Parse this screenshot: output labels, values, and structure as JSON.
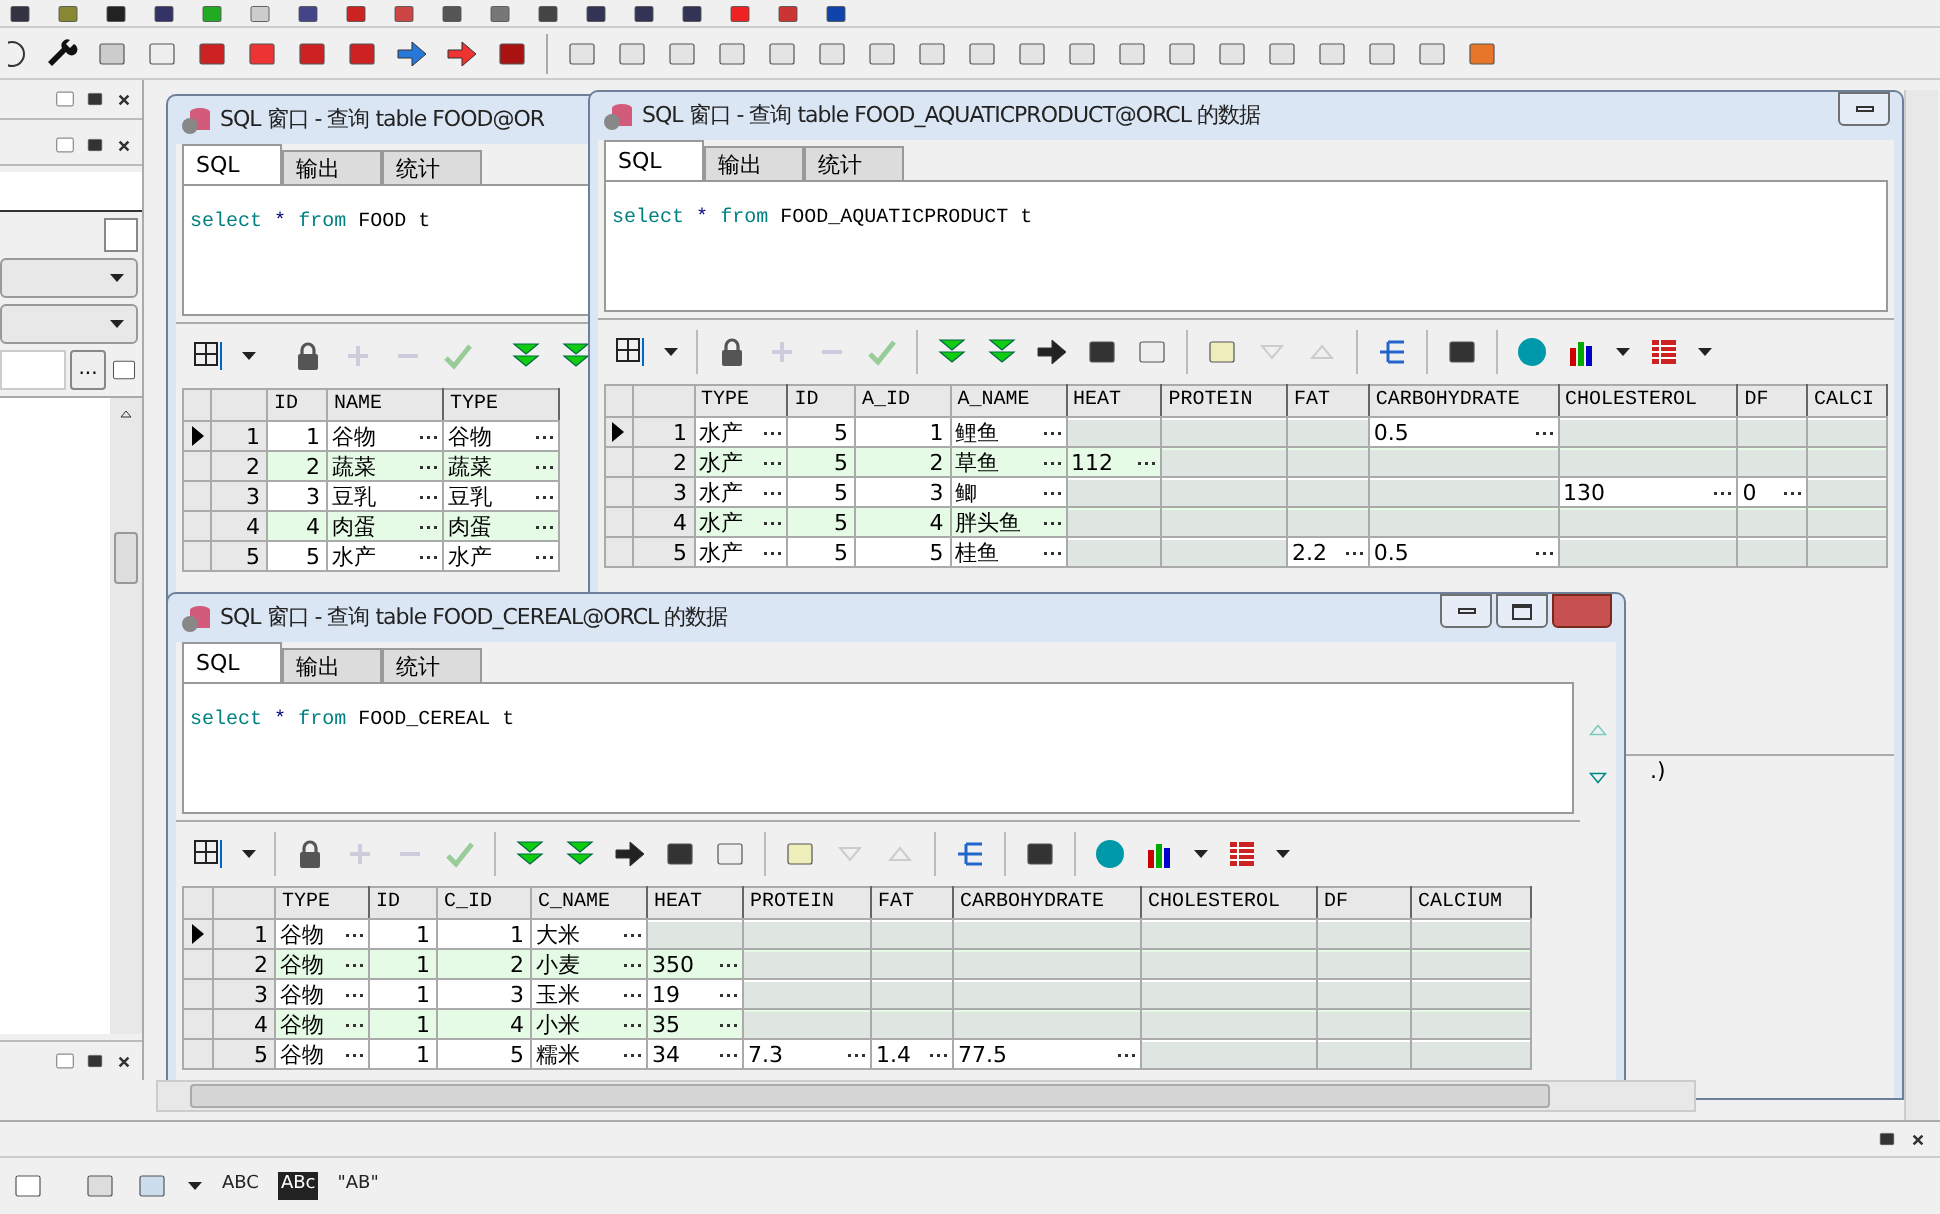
{
  "output_panel": {
    "toolbar_texts": [
      "ABC",
      "ABc",
      "\"AB\""
    ]
  },
  "left_panel": {
    "browse_button": "..."
  },
  "windows": [
    {
      "title": "SQL 窗口 - 查询 table FOOD@OR",
      "tabs": [
        {
          "label": "SQL",
          "selected": true
        },
        {
          "label": "输出",
          "selected": false
        },
        {
          "label": "统计",
          "selected": false
        }
      ],
      "sql": [
        {
          "kind": "keyword",
          "text": "select"
        },
        {
          "kind": "operator",
          "text": "*"
        },
        {
          "kind": "keyword",
          "text": "from"
        },
        {
          "kind": "plain",
          "text": "FOOD t"
        }
      ],
      "columns": [
        {
          "name": "ID",
          "kind": "number"
        },
        {
          "name": "NAME",
          "kind": "text"
        },
        {
          "name": "TYPE",
          "kind": "text"
        }
      ],
      "rows": [
        {
          "number": "1",
          "selected": true,
          "cells": [
            "1",
            "谷物",
            "谷物"
          ]
        },
        {
          "number": "2",
          "selected": false,
          "cells": [
            "2",
            "蔬菜",
            "蔬菜"
          ]
        },
        {
          "number": "3",
          "selected": false,
          "cells": [
            "3",
            "豆乳",
            "豆乳"
          ]
        },
        {
          "number": "4",
          "selected": false,
          "cells": [
            "4",
            "肉蛋",
            "肉蛋"
          ]
        },
        {
          "number": "5",
          "selected": false,
          "cells": [
            "5",
            "水产",
            "水产"
          ]
        }
      ]
    },
    {
      "title": "SQL 窗口 - 查询 table FOOD_AQUATICPRODUCT@ORCL 的数据",
      "tabs": [
        {
          "label": "SQL",
          "selected": true
        },
        {
          "label": "输出",
          "selected": false
        },
        {
          "label": "统计",
          "selected": false
        }
      ],
      "sql": [
        {
          "kind": "keyword",
          "text": "select"
        },
        {
          "kind": "operator",
          "text": "*"
        },
        {
          "kind": "keyword",
          "text": "from"
        },
        {
          "kind": "plain",
          "text": "FOOD_AQUATICPRODUCT t"
        }
      ],
      "columns": [
        {
          "name": "TYPE",
          "kind": "text"
        },
        {
          "name": "ID",
          "kind": "number"
        },
        {
          "name": "A_ID",
          "kind": "number"
        },
        {
          "name": "A_NAME",
          "kind": "text"
        },
        {
          "name": "HEAT",
          "kind": "text"
        },
        {
          "name": "PROTEIN",
          "kind": "text"
        },
        {
          "name": "FAT",
          "kind": "text"
        },
        {
          "name": "CARBOHYDRATE",
          "kind": "text"
        },
        {
          "name": "CHOLESTEROL",
          "kind": "text"
        },
        {
          "name": "DF",
          "kind": "text"
        },
        {
          "name": "CALCI",
          "kind": "text"
        }
      ],
      "rows": [
        {
          "number": "1",
          "selected": true,
          "cells": [
            "水产",
            "5",
            "1",
            "鲤鱼",
            null,
            null,
            null,
            "0.5",
            null,
            null,
            null
          ]
        },
        {
          "number": "2",
          "selected": false,
          "cells": [
            "水产",
            "5",
            "2",
            "草鱼",
            "112",
            null,
            null,
            null,
            null,
            null,
            null
          ]
        },
        {
          "number": "3",
          "selected": false,
          "cells": [
            "水产",
            "5",
            "3",
            "鲫",
            null,
            null,
            null,
            null,
            "130",
            "0",
            null
          ]
        },
        {
          "number": "4",
          "selected": false,
          "cells": [
            "水产",
            "5",
            "4",
            "胖头鱼",
            null,
            null,
            null,
            null,
            null,
            null,
            null
          ]
        },
        {
          "number": "5",
          "selected": false,
          "cells": [
            "水产",
            "5",
            "5",
            "桂鱼",
            null,
            null,
            "2.2",
            "0.5",
            null,
            null,
            null
          ]
        }
      ],
      "status": ".)"
    },
    {
      "title": "SQL 窗口 - 查询 table FOOD_CEREAL@ORCL 的数据",
      "tabs": [
        {
          "label": "SQL",
          "selected": true
        },
        {
          "label": "输出",
          "selected": false
        },
        {
          "label": "统计",
          "selected": false
        }
      ],
      "sql": [
        {
          "kind": "keyword",
          "text": "select"
        },
        {
          "kind": "operator",
          "text": "*"
        },
        {
          "kind": "keyword",
          "text": "from"
        },
        {
          "kind": "plain",
          "text": "FOOD_CEREAL t"
        }
      ],
      "columns": [
        {
          "name": "TYPE",
          "kind": "text"
        },
        {
          "name": "ID",
          "kind": "number"
        },
        {
          "name": "C_ID",
          "kind": "number"
        },
        {
          "name": "C_NAME",
          "kind": "text"
        },
        {
          "name": "HEAT",
          "kind": "text"
        },
        {
          "name": "PROTEIN",
          "kind": "text"
        },
        {
          "name": "FAT",
          "kind": "text"
        },
        {
          "name": "CARBOHYDRATE",
          "kind": "text"
        },
        {
          "name": "CHOLESTEROL",
          "kind": "text"
        },
        {
          "name": "DF",
          "kind": "text"
        },
        {
          "name": "CALCIUM",
          "kind": "text"
        }
      ],
      "rows": [
        {
          "number": "1",
          "selected": true,
          "cells": [
            "谷物",
            "1",
            "1",
            "大米",
            null,
            null,
            null,
            null,
            null,
            null,
            null
          ]
        },
        {
          "number": "2",
          "selected": false,
          "cells": [
            "谷物",
            "1",
            "2",
            "小麦",
            "350",
            null,
            null,
            null,
            null,
            null,
            null
          ]
        },
        {
          "number": "3",
          "selected": false,
          "cells": [
            "谷物",
            "1",
            "3",
            "玉米",
            "19",
            null,
            null,
            null,
            null,
            null,
            null
          ]
        },
        {
          "number": "4",
          "selected": false,
          "cells": [
            "谷物",
            "1",
            "4",
            "小米",
            "35",
            null,
            null,
            null,
            null,
            null,
            null
          ]
        },
        {
          "number": "5",
          "selected": false,
          "cells": [
            "谷物",
            "1",
            "5",
            "糯米",
            "34",
            "7.3",
            "1.4",
            "77.5",
            null,
            null,
            null
          ]
        }
      ]
    }
  ]
}
